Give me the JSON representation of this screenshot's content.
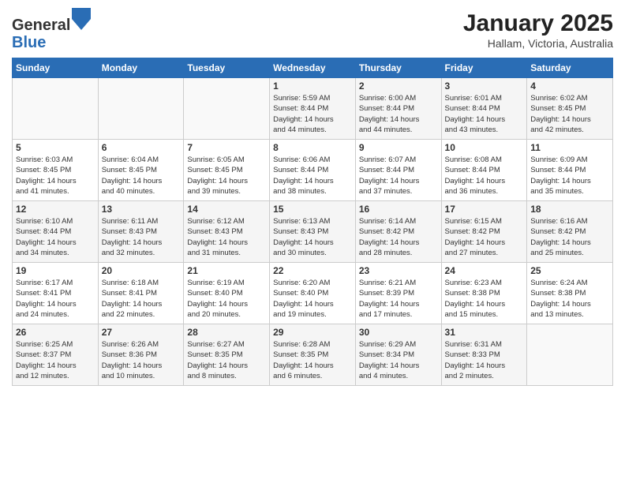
{
  "header": {
    "logo_general": "General",
    "logo_blue": "Blue",
    "month": "January 2025",
    "location": "Hallam, Victoria, Australia"
  },
  "days_of_week": [
    "Sunday",
    "Monday",
    "Tuesday",
    "Wednesday",
    "Thursday",
    "Friday",
    "Saturday"
  ],
  "weeks": [
    [
      {
        "day": "",
        "info": ""
      },
      {
        "day": "",
        "info": ""
      },
      {
        "day": "",
        "info": ""
      },
      {
        "day": "1",
        "info": "Sunrise: 5:59 AM\nSunset: 8:44 PM\nDaylight: 14 hours\nand 44 minutes."
      },
      {
        "day": "2",
        "info": "Sunrise: 6:00 AM\nSunset: 8:44 PM\nDaylight: 14 hours\nand 44 minutes."
      },
      {
        "day": "3",
        "info": "Sunrise: 6:01 AM\nSunset: 8:44 PM\nDaylight: 14 hours\nand 43 minutes."
      },
      {
        "day": "4",
        "info": "Sunrise: 6:02 AM\nSunset: 8:45 PM\nDaylight: 14 hours\nand 42 minutes."
      }
    ],
    [
      {
        "day": "5",
        "info": "Sunrise: 6:03 AM\nSunset: 8:45 PM\nDaylight: 14 hours\nand 41 minutes."
      },
      {
        "day": "6",
        "info": "Sunrise: 6:04 AM\nSunset: 8:45 PM\nDaylight: 14 hours\nand 40 minutes."
      },
      {
        "day": "7",
        "info": "Sunrise: 6:05 AM\nSunset: 8:45 PM\nDaylight: 14 hours\nand 39 minutes."
      },
      {
        "day": "8",
        "info": "Sunrise: 6:06 AM\nSunset: 8:44 PM\nDaylight: 14 hours\nand 38 minutes."
      },
      {
        "day": "9",
        "info": "Sunrise: 6:07 AM\nSunset: 8:44 PM\nDaylight: 14 hours\nand 37 minutes."
      },
      {
        "day": "10",
        "info": "Sunrise: 6:08 AM\nSunset: 8:44 PM\nDaylight: 14 hours\nand 36 minutes."
      },
      {
        "day": "11",
        "info": "Sunrise: 6:09 AM\nSunset: 8:44 PM\nDaylight: 14 hours\nand 35 minutes."
      }
    ],
    [
      {
        "day": "12",
        "info": "Sunrise: 6:10 AM\nSunset: 8:44 PM\nDaylight: 14 hours\nand 34 minutes."
      },
      {
        "day": "13",
        "info": "Sunrise: 6:11 AM\nSunset: 8:43 PM\nDaylight: 14 hours\nand 32 minutes."
      },
      {
        "day": "14",
        "info": "Sunrise: 6:12 AM\nSunset: 8:43 PM\nDaylight: 14 hours\nand 31 minutes."
      },
      {
        "day": "15",
        "info": "Sunrise: 6:13 AM\nSunset: 8:43 PM\nDaylight: 14 hours\nand 30 minutes."
      },
      {
        "day": "16",
        "info": "Sunrise: 6:14 AM\nSunset: 8:42 PM\nDaylight: 14 hours\nand 28 minutes."
      },
      {
        "day": "17",
        "info": "Sunrise: 6:15 AM\nSunset: 8:42 PM\nDaylight: 14 hours\nand 27 minutes."
      },
      {
        "day": "18",
        "info": "Sunrise: 6:16 AM\nSunset: 8:42 PM\nDaylight: 14 hours\nand 25 minutes."
      }
    ],
    [
      {
        "day": "19",
        "info": "Sunrise: 6:17 AM\nSunset: 8:41 PM\nDaylight: 14 hours\nand 24 minutes."
      },
      {
        "day": "20",
        "info": "Sunrise: 6:18 AM\nSunset: 8:41 PM\nDaylight: 14 hours\nand 22 minutes."
      },
      {
        "day": "21",
        "info": "Sunrise: 6:19 AM\nSunset: 8:40 PM\nDaylight: 14 hours\nand 20 minutes."
      },
      {
        "day": "22",
        "info": "Sunrise: 6:20 AM\nSunset: 8:40 PM\nDaylight: 14 hours\nand 19 minutes."
      },
      {
        "day": "23",
        "info": "Sunrise: 6:21 AM\nSunset: 8:39 PM\nDaylight: 14 hours\nand 17 minutes."
      },
      {
        "day": "24",
        "info": "Sunrise: 6:23 AM\nSunset: 8:38 PM\nDaylight: 14 hours\nand 15 minutes."
      },
      {
        "day": "25",
        "info": "Sunrise: 6:24 AM\nSunset: 8:38 PM\nDaylight: 14 hours\nand 13 minutes."
      }
    ],
    [
      {
        "day": "26",
        "info": "Sunrise: 6:25 AM\nSunset: 8:37 PM\nDaylight: 14 hours\nand 12 minutes."
      },
      {
        "day": "27",
        "info": "Sunrise: 6:26 AM\nSunset: 8:36 PM\nDaylight: 14 hours\nand 10 minutes."
      },
      {
        "day": "28",
        "info": "Sunrise: 6:27 AM\nSunset: 8:35 PM\nDaylight: 14 hours\nand 8 minutes."
      },
      {
        "day": "29",
        "info": "Sunrise: 6:28 AM\nSunset: 8:35 PM\nDaylight: 14 hours\nand 6 minutes."
      },
      {
        "day": "30",
        "info": "Sunrise: 6:29 AM\nSunset: 8:34 PM\nDaylight: 14 hours\nand 4 minutes."
      },
      {
        "day": "31",
        "info": "Sunrise: 6:31 AM\nSunset: 8:33 PM\nDaylight: 14 hours\nand 2 minutes."
      },
      {
        "day": "",
        "info": ""
      }
    ]
  ]
}
